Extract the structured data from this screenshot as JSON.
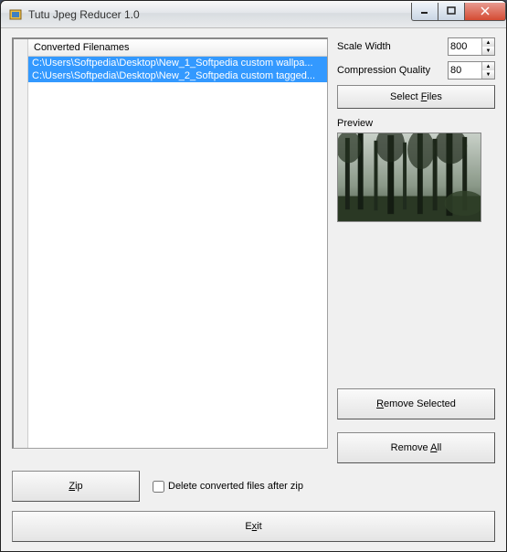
{
  "window": {
    "title": "Tutu Jpeg Reducer 1.0"
  },
  "filelist": {
    "header": "Converted Filenames",
    "items": [
      "C:\\Users\\Softpedia\\Desktop\\New_1_Softpedia custom wallpa...",
      "C:\\Users\\Softpedia\\Desktop\\New_2_Softpedia custom tagged..."
    ]
  },
  "controls": {
    "scale_width_label": "Scale Width",
    "scale_width_value": "800",
    "compression_label": "Compression Quality",
    "compression_value": "80",
    "select_files": "Select Files",
    "preview_label": "Preview",
    "remove_selected": "Remove Selected",
    "remove_all": "Remove All",
    "zip": "Zip",
    "delete_after_zip": "Delete converted files after zip",
    "exit": "Exit"
  }
}
